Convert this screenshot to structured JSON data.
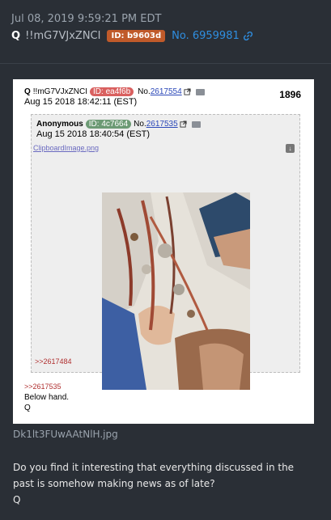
{
  "post": {
    "timestamp": "Jul 08, 2019 9:59:21 PM EDT",
    "name": "Q",
    "tripcode": "!!mG7VJxZNCI",
    "id_badge": "ID: b9603d",
    "post_number": "No. 6959981",
    "filename": "Dk1lt3FUwAAtNlH.jpg",
    "message_line1": "Do you find it interesting that everything discussed in the",
    "message_line2": "past is somehow making news as of late?",
    "message_line3": "Q"
  },
  "embedded": {
    "q_name": "Q",
    "tripcode": "!!mG7VJxZNCI",
    "id": "ID: ea4f6b",
    "no_prefix": "No.",
    "no": "2617554",
    "date": "Aug 15 2018 18:42:11 (EST)",
    "count": "1896",
    "nested": {
      "name": "Anonymous",
      "id": "ID: 4c7664",
      "no_prefix": "No.",
      "no": "2617535",
      "date": "Aug 15 2018 18:40:54 (EST)",
      "file": "ClipboardImage.png",
      "reply_link": ">>2617484"
    },
    "reply": ">>2617535",
    "text1": "Below hand.",
    "text2": "Q"
  },
  "colors": {
    "accent": "#2f8ee0",
    "id_badge": "#c05a2a",
    "background": "#2a2f36"
  }
}
